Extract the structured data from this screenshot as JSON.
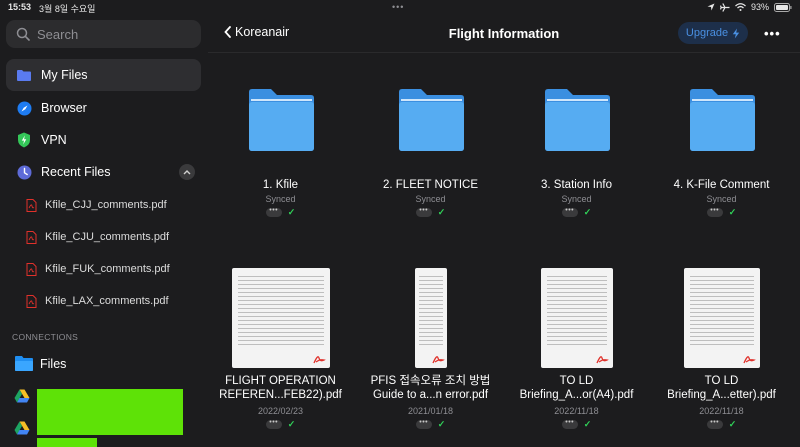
{
  "status": {
    "time": "15:53",
    "date": "3월 8일 수요일",
    "battery": "93%"
  },
  "sidebar": {
    "search_placeholder": "Search",
    "items": [
      {
        "label": "My Files",
        "icon": "folder-icon",
        "active": true
      },
      {
        "label": "Browser",
        "icon": "compass-icon"
      },
      {
        "label": "VPN",
        "icon": "shield-icon"
      },
      {
        "label": "Recent Files",
        "icon": "clock-icon"
      }
    ],
    "recent_files": [
      "Kfile_CJJ_comments.pdf",
      "Kfile_CJU_comments.pdf",
      "Kfile_FUK_comments.pdf",
      "Kfile_LAX_comments.pdf"
    ],
    "connections_label": "CONNECTIONS",
    "connections": [
      {
        "label": "Files",
        "icon": "files-app-icon"
      },
      {
        "label": "",
        "icon": "google-drive-icon"
      },
      {
        "label": "",
        "icon": "google-drive-icon"
      }
    ]
  },
  "header": {
    "back_label": "Koreanair",
    "title": "Flight Information",
    "upgrade_label": "Upgrade"
  },
  "folders": [
    {
      "name": "1. Kfile",
      "status": "Synced"
    },
    {
      "name": "2. FLEET NOTICE",
      "status": "Synced"
    },
    {
      "name": "3. Station Info",
      "status": "Synced"
    },
    {
      "name": "4. K-File Comment",
      "status": "Synced"
    }
  ],
  "documents": [
    {
      "line1": "FLIGHT OPERATION",
      "line2": "REFEREN...FEB22).pdf",
      "date": "2022/02/23",
      "orientation": "landscape"
    },
    {
      "line1": "PFIS 접속오류 조치 방법",
      "line2": "Guide to a...n error.pdf",
      "date": "2021/01/18",
      "orientation": "portrait"
    },
    {
      "line1": "TO LD",
      "line2": "Briefing_A...or(A4).pdf",
      "date": "2022/11/18",
      "orientation": "portrait"
    },
    {
      "line1": "TO LD",
      "line2": "Briefing_A...etter).pdf",
      "date": "2022/11/18",
      "orientation": "portrait"
    }
  ],
  "colors": {
    "accent": "#0a84ff",
    "folder": "#4aa3f0",
    "synced": "#30d158",
    "pdf_red": "#e0312b"
  }
}
